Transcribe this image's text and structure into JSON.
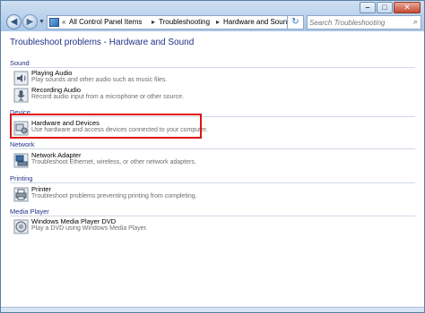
{
  "window": {
    "caption_buttons": [
      "minimize",
      "maximize",
      "close"
    ]
  },
  "nav": {
    "back_icon": "back-arrow-icon",
    "forward_icon": "forward-arrow-icon"
  },
  "address": {
    "root_separator": "«",
    "breadcrumbs": [
      "All Control Panel Items",
      "Troubleshooting",
      "Hardware and Sound"
    ],
    "separator": "▸"
  },
  "search": {
    "placeholder": "Search Troubleshooting"
  },
  "page": {
    "title": "Troubleshoot problems - Hardware and Sound"
  },
  "groups": [
    {
      "header": "Sound",
      "items": [
        {
          "title": "Playing Audio",
          "description": "Play sounds and other audio such as music files.",
          "icon": "speaker-icon"
        },
        {
          "title": "Recording Audio",
          "description": "Record audio input from a microphone or other source.",
          "icon": "microphone-icon"
        }
      ]
    },
    {
      "header": "Device",
      "items": [
        {
          "title": "Hardware and Devices",
          "description": "Use hardware and access devices connected to your computer.",
          "icon": "hardware-icon"
        }
      ]
    },
    {
      "header": "Network",
      "items": [
        {
          "title": "Network Adapter",
          "description": "Troubleshoot Ethernet, wireless, or other network adapters.",
          "icon": "network-adapter-icon"
        }
      ]
    },
    {
      "header": "Printing",
      "items": [
        {
          "title": "Printer",
          "description": "Troubleshoot problems preventing printing from completing.",
          "icon": "printer-icon"
        }
      ]
    },
    {
      "header": "Media Player",
      "items": [
        {
          "title": "Windows Media Player DVD",
          "description": "Play a DVD using Windows Media Player.",
          "icon": "dvd-icon"
        }
      ]
    }
  ],
  "colors": {
    "link_blue": "#1e3287",
    "highlight_red": "#e01414",
    "description_gray": "#6d6d6d"
  }
}
